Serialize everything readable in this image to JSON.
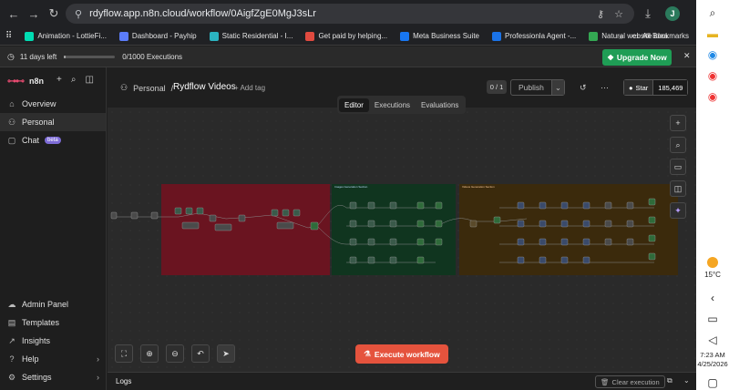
{
  "browser": {
    "url": "rdyflow.app.n8n.cloud/workflow/0AigfZgE0MgJ3sLr",
    "profile_initial": "J",
    "bookmarks": [
      {
        "label": "Animation - LottieFi...",
        "color": "#00ddb3"
      },
      {
        "label": "Dashboard - Payhip",
        "color": "#5b7cfa"
      },
      {
        "label": "Static Residential - I...",
        "color": "#2bb3c0"
      },
      {
        "label": "Get paid by helping...",
        "color": "#e04a3f"
      },
      {
        "label": "Meta Business Suite",
        "color": "#1877f2"
      },
      {
        "label": "Professionla Agent -...",
        "color": "#1a73e8"
      },
      {
        "label": "Natural website idea",
        "color": "#34a853"
      }
    ],
    "all_bookmarks": "All Bookmarks"
  },
  "banner": {
    "trial_text": "11 days left",
    "trial_progress": 0.0,
    "executions": "0/1000 Executions",
    "upgrade_label": "Upgrade Now"
  },
  "sidebar": {
    "brand": "n8n",
    "items": [
      {
        "label": "Overview",
        "icon": "home-icon"
      },
      {
        "label": "Personal",
        "icon": "user-icon"
      },
      {
        "label": "Chat",
        "icon": "chat-icon",
        "badge": "beta"
      }
    ],
    "bottom_items": [
      {
        "label": "Admin Panel",
        "icon": "cloud-icon"
      },
      {
        "label": "Templates",
        "icon": "templates-icon"
      },
      {
        "label": "Insights",
        "icon": "insights-icon"
      },
      {
        "label": "Help",
        "icon": "help-icon"
      },
      {
        "label": "Settings",
        "icon": "gear-icon"
      }
    ]
  },
  "header": {
    "project": "Personal",
    "separator": "/",
    "workflow_name": "Rydflow Videos",
    "add_tag": "+ Add tag",
    "counter": "0 / 1",
    "publish_label": "Publish",
    "github_star": "Star",
    "github_count": "185,469"
  },
  "tabs": [
    "Editor",
    "Executions",
    "Evaluations"
  ],
  "canvas": {
    "sticky_titles": [
      "",
      "Images Generation Section",
      "Videos Generation Section"
    ],
    "sticky_colors": [
      "#6a1420",
      "#10351f",
      "#3b2a0c"
    ]
  },
  "execute_label": "Execute workflow",
  "logs": {
    "label": "Logs",
    "clear_label": "Clear execution"
  },
  "taskbar": {
    "temperature": "15°C",
    "time": "7:23 AM",
    "date": "4/25/2026"
  }
}
